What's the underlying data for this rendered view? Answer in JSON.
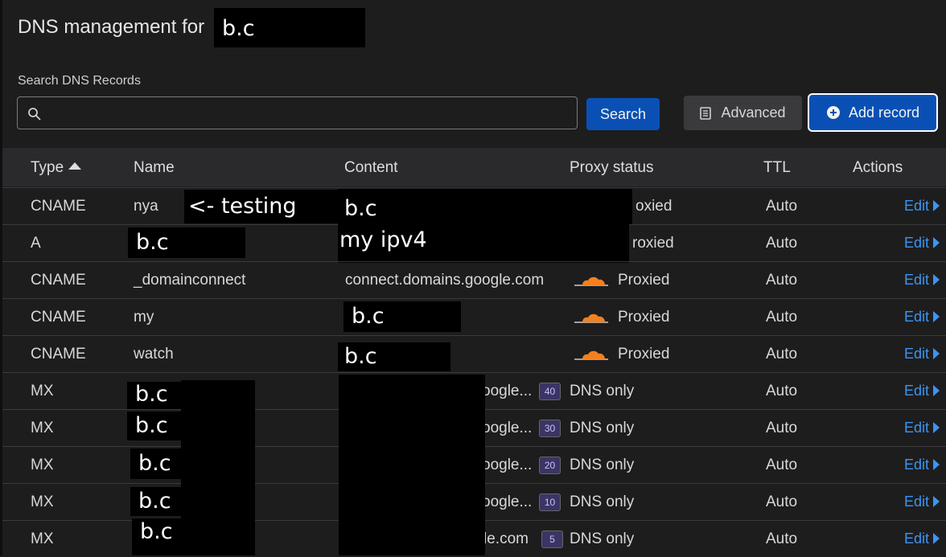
{
  "header": {
    "title": "DNS management for",
    "domain_redacted": "b.c"
  },
  "search": {
    "label": "Search DNS Records",
    "value": "",
    "placeholder": "",
    "button_label": "Search"
  },
  "toolbar": {
    "advanced_label": "Advanced",
    "add_record_label": "Add record"
  },
  "table": {
    "columns": [
      "Type",
      "Name",
      "Content",
      "Proxy status",
      "TTL",
      "Actions"
    ],
    "sort_column": "Type",
    "sort_direction": "ascending",
    "rows": [
      {
        "type": "CNAME",
        "name": "nya",
        "name_note": "<- testing",
        "content": "b.c",
        "proxy": "Proxied",
        "ttl": "Auto",
        "action": "Edit"
      },
      {
        "type": "A",
        "name": "b.c",
        "content": "my ipv4",
        "proxy": "Proxied",
        "ttl": "Auto",
        "action": "Edit"
      },
      {
        "type": "CNAME",
        "name": "_domainconnect",
        "content": "connect.domains.google.com",
        "proxy": "Proxied",
        "ttl": "Auto",
        "action": "Edit"
      },
      {
        "type": "CNAME",
        "name": "my",
        "content": "b.c",
        "proxy": "Proxied",
        "ttl": "Auto",
        "action": "Edit"
      },
      {
        "type": "CNAME",
        "name": "watch",
        "content": "b.c",
        "proxy": "Proxied",
        "ttl": "Auto",
        "action": "Edit"
      },
      {
        "type": "MX",
        "name": "b.c",
        "content": "oogle...",
        "priority": "40",
        "proxy": "DNS only",
        "ttl": "Auto",
        "action": "Edit"
      },
      {
        "type": "MX",
        "name": "b.c",
        "content": "oogle...",
        "priority": "30",
        "proxy": "DNS only",
        "ttl": "Auto",
        "action": "Edit"
      },
      {
        "type": "MX",
        "name": "b.c",
        "content": "oogle...",
        "priority": "20",
        "proxy": "DNS only",
        "ttl": "Auto",
        "action": "Edit"
      },
      {
        "type": "MX",
        "name": "b.c",
        "content": "oogle...",
        "priority": "10",
        "proxy": "DNS only",
        "ttl": "Auto",
        "action": "Edit"
      },
      {
        "type": "MX",
        "name": "b.c",
        "content": "le.com",
        "priority": "5",
        "proxy": "DNS only",
        "ttl": "Auto",
        "action": "Edit"
      }
    ]
  },
  "colors": {
    "background": "#1d1d1e",
    "accent_blue": "#0a50b4",
    "link_blue": "#3b95f2",
    "cloud_orange": "#f38020",
    "priority_badge": "#3a3563"
  },
  "icons": {
    "search": "magnifier-icon",
    "advanced": "document-icon",
    "add": "plus-circle-icon",
    "proxied": "orange-cloud-icon",
    "edit": "chevron-right-icon",
    "sort": "sort-up-icon"
  }
}
